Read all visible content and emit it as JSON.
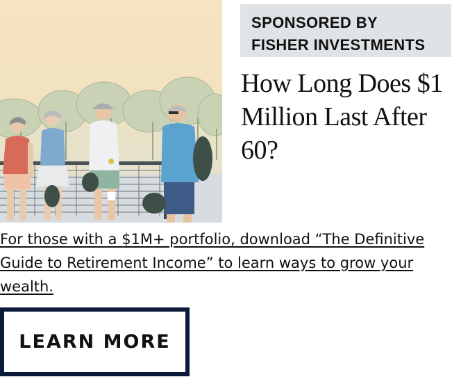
{
  "sponsor": {
    "line1": "SPONSORED BY",
    "line2": "FISHER INVESTMENTS"
  },
  "headline": "How Long Does $1 Million Last After 60?",
  "description": "For those with a $1M+ portfolio, download “The Definitive Guide to Retirement Income” to learn ways to grow your wealth.",
  "cta": {
    "label": "LEARN MORE"
  },
  "colors": {
    "badge_bg": "#dfe3e6",
    "cta_border": "#0b1a3b",
    "text": "#111111"
  }
}
